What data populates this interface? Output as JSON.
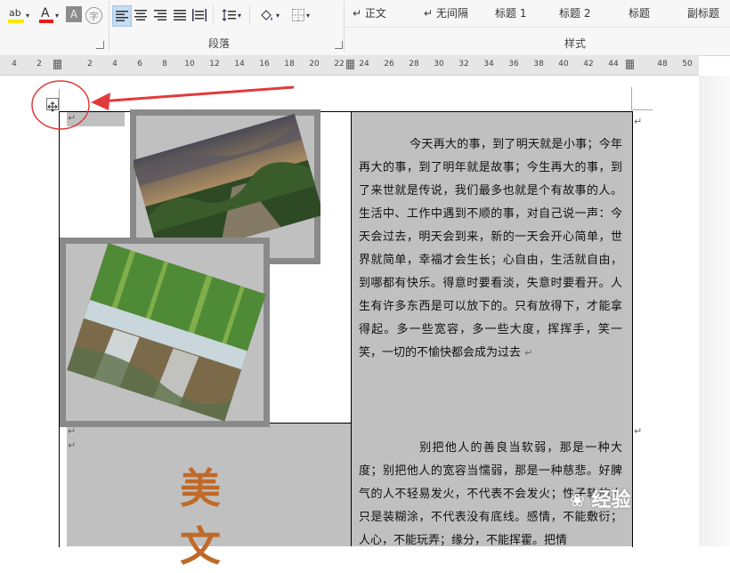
{
  "ribbon": {
    "paragraph_label": "段落",
    "styles_label": "样式",
    "styles": [
      "↵ 正文",
      "↵ 无间隔",
      "标题 1",
      "标题 2",
      "标题",
      "副标题"
    ],
    "font_color_letter": "A",
    "char_border_letter": "A",
    "phonetic_glyph": "字",
    "highlight_letters": "ab",
    "font_color_accent": "#e0201b",
    "highlight_accent": "#ffe600"
  },
  "ruler": {
    "numbers": [
      "4",
      "2",
      "2",
      "4",
      "6",
      "8",
      "10",
      "12",
      "14",
      "16",
      "18",
      "20",
      "22",
      "24",
      "26",
      "28",
      "30",
      "32",
      "34",
      "36",
      "38",
      "40",
      "42",
      "44",
      "48",
      "50"
    ]
  },
  "document": {
    "para1": "今天再大的事，到了明天就是小事；今年再大的事，到了明年就是故事；今生再大的事，到了来世就是传说，我们最多也就是个有故事的人。生活中、工作中遇到不顺的事，对自己说一声：今天会过去，明天会到来，新的一天会开心简单，世界就简单，幸福才会生长；心自由，生活就自由，到哪都有快乐。得意时要看淡，失意时要看开。人生有许多东西是可以放下的。只有放得下，才能拿得起。多一些宽容，多一些大度，挥挥手，笑一笑，一切的不愉快都会成为过去",
    "para2": "别把他人的善良当软弱，那是一种大度；别把他人的宽容当懦弱，那是一种慈悲。好脾气的人不轻易发火，不代表不会发火；性子软的人只是装糊涂，不代表没有底线。感情，不能敷衍；人心，不能玩弄；缘分，不能挥霍。把情",
    "big_chars": [
      "美",
      "文"
    ],
    "return_mark": "↵"
  },
  "watermark": "经验"
}
